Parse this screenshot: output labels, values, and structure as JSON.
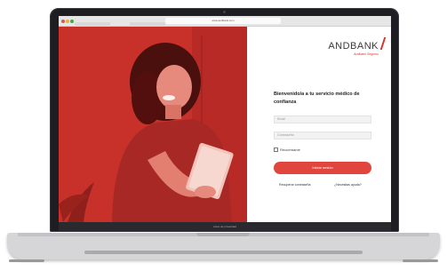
{
  "browser": {
    "url": "www.andbank.com",
    "dots": [
      "close",
      "minimize",
      "maximize"
    ]
  },
  "login": {
    "logo": "ANDBANK",
    "logo_sub": "Andbank Seguros",
    "welcome": "Bienvenido/a a tu servicio médico de confianza",
    "email_placeholder": "Email",
    "password_placeholder": "Contraseña",
    "remember_label": "Recuérdame",
    "submit_label": "Iniciar sesión",
    "recover_link": "Recuperar contraseña",
    "help_link": "¿Necesitas ayuda?"
  },
  "footer": {
    "text": "Aviso de privacidad"
  },
  "colors": {
    "brand_red": "#d8322c",
    "button_red": "#e0453e"
  }
}
